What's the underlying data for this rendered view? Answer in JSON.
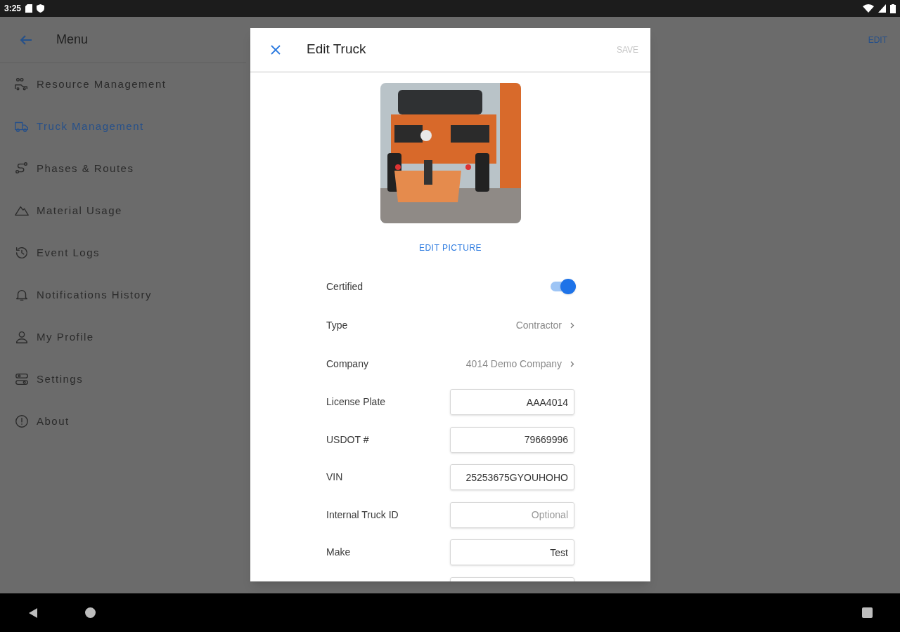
{
  "status_bar": {
    "time": "3:25"
  },
  "app_bar": {
    "title": "Menu",
    "action": "EDIT"
  },
  "sidebar": {
    "items": [
      {
        "label": "Resource Management",
        "selected": false
      },
      {
        "label": "Truck Management",
        "selected": true
      },
      {
        "label": "Phases & Routes",
        "selected": false
      },
      {
        "label": "Material Usage",
        "selected": false
      },
      {
        "label": "Event Logs",
        "selected": false
      },
      {
        "label": "Notifications History",
        "selected": false
      },
      {
        "label": "My Profile",
        "selected": false
      },
      {
        "label": "Settings",
        "selected": false
      },
      {
        "label": "About",
        "selected": false
      }
    ]
  },
  "dialog": {
    "title": "Edit Truck",
    "save": {
      "label": "SAVE",
      "disabled": true
    },
    "edit_picture": "EDIT PICTURE",
    "fields": [
      {
        "kind": "toggle",
        "label": "Certified",
        "on": true
      },
      {
        "kind": "select",
        "label": "Type",
        "value": "Contractor"
      },
      {
        "kind": "select",
        "label": "Company",
        "value": "4014 Demo Company"
      },
      {
        "kind": "input",
        "label": "License Plate",
        "value": "AAA4014"
      },
      {
        "kind": "input",
        "label": "USDOT #",
        "value": "79669996"
      },
      {
        "kind": "input",
        "label": "VIN",
        "value": "25253675GYOUHOHO"
      },
      {
        "kind": "input",
        "label": "Internal Truck ID",
        "placeholder": "Optional"
      },
      {
        "kind": "input",
        "label": "Make",
        "value": "Test"
      },
      {
        "kind": "input"
      }
    ]
  }
}
